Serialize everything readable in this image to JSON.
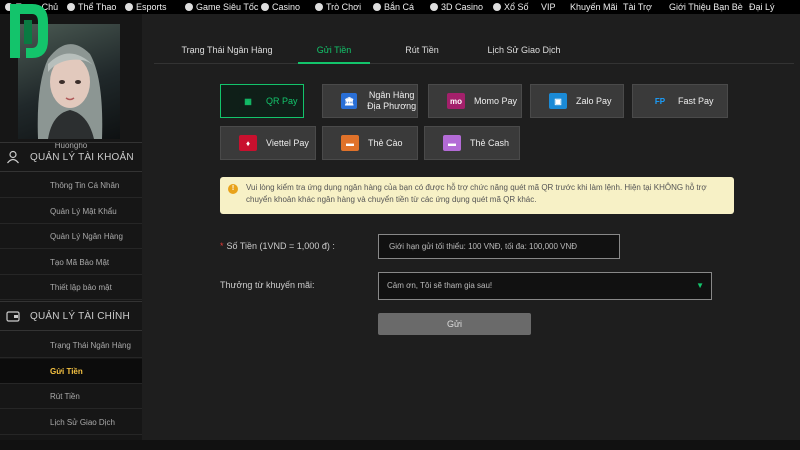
{
  "topnav": {
    "items": [
      {
        "label": "Trang Chủ",
        "icon": "home-icon"
      },
      {
        "label": "Thể Thao",
        "icon": "soccer-ball-icon"
      },
      {
        "label": "Esports",
        "icon": "gamepad-icon"
      },
      {
        "label": "Game Siêu Tốc",
        "icon": "dice-icon"
      },
      {
        "label": "Casino",
        "icon": "casino-chip-icon"
      },
      {
        "label": "Trò Chơi",
        "icon": "slot-icon"
      },
      {
        "label": "Bắn Cá",
        "icon": "fish-icon"
      },
      {
        "label": "3D Casino",
        "icon": "3d-icon"
      },
      {
        "label": "Xổ Số",
        "icon": "lottery-icon"
      },
      {
        "label": "VIP",
        "icon": ""
      },
      {
        "label": "Khuyến Mãi",
        "icon": ""
      },
      {
        "label": "Tài Trợ",
        "icon": ""
      },
      {
        "label": "Giới Thiệu Bạn Bè",
        "icon": ""
      },
      {
        "label": "Đại Lý",
        "icon": ""
      }
    ]
  },
  "sidebar": {
    "username": "Huongho",
    "account_section": {
      "label": "QUẢN LÝ TÀI KHOẢN",
      "icon": "user-icon",
      "items": [
        "Thông Tin Cá Nhân",
        "Quản Lý Mật Khẩu",
        "Quản Lý Ngân Hàng",
        "Tạo Mã Bảo Mật",
        "Thiết lập bảo mật"
      ]
    },
    "finance_section": {
      "label": "QUẢN LÝ TÀI CHÍNH",
      "icon": "wallet-icon",
      "items": [
        "Trạng Thái Ngân Hàng",
        "Gửi Tiền",
        "Rút Tiền",
        "Lịch Sử Giao Dịch"
      ],
      "active_item": "Gửi Tiền"
    }
  },
  "tabs": [
    {
      "label": "Trạng Thái Ngân Hàng",
      "active": false
    },
    {
      "label": "Gửi Tiền",
      "active": true
    },
    {
      "label": "Rút Tiền",
      "active": false
    },
    {
      "label": "Lịch Sử Giao Dịch",
      "active": false
    }
  ],
  "payment_methods": [
    {
      "label": "QR Pay",
      "icon": "qr-code-icon",
      "active": true
    },
    {
      "label": "Ngân Hàng Địa Phương",
      "icon": "bank-icon",
      "active": false
    },
    {
      "label": "Momo Pay",
      "icon": "momo-icon",
      "active": false
    },
    {
      "label": "Zalo Pay",
      "icon": "zalo-pay-icon",
      "active": false
    },
    {
      "label": "Fast Pay",
      "icon": "fast-pay-icon",
      "active": false
    },
    {
      "label": "Viettel Pay",
      "icon": "viettel-pay-icon",
      "active": false
    },
    {
      "label": "Thẻ Cào",
      "icon": "scratch-card-icon",
      "active": false
    },
    {
      "label": "Thẻ Cash",
      "icon": "cash-card-icon",
      "active": false
    }
  ],
  "notice": {
    "text": "Vui lòng kiểm tra ứng dụng ngân hàng của bạn có được hỗ trợ chức năng quét mã QR trước khi làm lệnh. Hiện tại KHÔNG hỗ trợ chuyển khoản khác ngân hàng và chuyển tiền từ các ứng dụng quét mã QR khác."
  },
  "form": {
    "amount_label": "Số Tiền (1VND = 1,000 đ) :",
    "amount_required_mark": "*",
    "amount_placeholder": "Giới hạn gửi tối thiểu: 100 VNĐ, tối đa: 100,000 VNĐ",
    "promo_label": "Thưởng từ khuyến mãi:",
    "promo_selected": "Cảm ơn, Tôi sẽ tham gia sau!",
    "submit_label": "Gửi"
  },
  "colors": {
    "accent": "#13c46b",
    "active_sidebar": "#f5c242",
    "notice_bg": "#f7f1c6"
  }
}
